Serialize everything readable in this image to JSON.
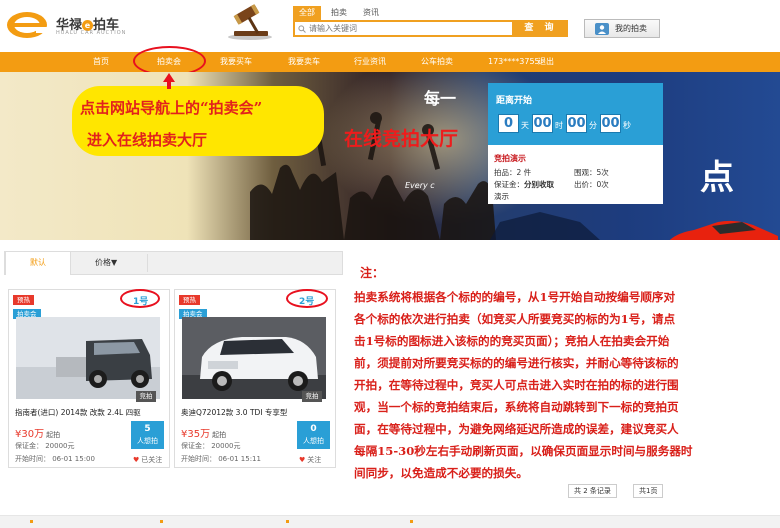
{
  "brand": {
    "name": "华禄",
    "badge": "e",
    "suffix": "拍车",
    "sub": "HUALU CAR AUCTION"
  },
  "search": {
    "tabs": [
      "全部",
      "拍卖",
      "资讯"
    ],
    "placeholder": "请输入关键词",
    "button": "查 询"
  },
  "my_auction": "我的拍卖",
  "nav": {
    "items": [
      "首页",
      "拍卖会",
      "我要买车",
      "我要卖车",
      "行业资讯",
      "公车拍卖"
    ],
    "user": "173****3755",
    "logout": "退出"
  },
  "banner": {
    "note_lines": [
      "点击网站导航上的“拍卖会”",
      "进入在线拍卖大厅"
    ],
    "title": "在线竞拍大厅",
    "every_text": "Every c",
    "dot_char": "点",
    "wave_text": "每一"
  },
  "countdown": {
    "label": "距离开始",
    "values": [
      "0",
      "00",
      "00",
      "00"
    ],
    "units": [
      "天",
      "时",
      "分",
      "秒"
    ],
    "title": "竞拍演示",
    "lots_label": "拍品：",
    "lots_value": "2 件",
    "views_label": "围观：",
    "views_value": "5次",
    "deposit_label": "保证金：",
    "deposit_value": "分别收取",
    "bids_label": "出价：",
    "bids_value": "0次",
    "demo": "演示"
  },
  "tabs": {
    "default": "默认",
    "price": "价格▼"
  },
  "cards": [
    {
      "badge_red": "预热",
      "badge_blue": "拍卖会",
      "number": "1号",
      "tag": "竞拍",
      "title": "指南者(进口) 2014款 改款 2.4L 四驱",
      "price": "¥30万",
      "price_suffix": "起拍",
      "deposit": "保证金：  20000元",
      "start": "开始时间：  06-01 15:00",
      "bidders_count": "5",
      "bidders_label": "人想拍",
      "follow": "已关注"
    },
    {
      "badge_red": "预热",
      "badge_blue": "拍卖会",
      "number": "2号",
      "tag": "竞拍",
      "title": "奥迪Q72012款 3.0 TDI 专享型",
      "price": "¥35万",
      "price_suffix": "起拍",
      "deposit": "保证金：  20000元",
      "start": "开始时间：  06-01 15:11",
      "bidders_count": "0",
      "bidders_label": "人想拍",
      "follow": "关注"
    }
  ],
  "note": {
    "head": "注：",
    "lines": [
      "拍卖系统将根据各个标的的编号，从1号开始自动按编号顺序对",
      "各个标的依次进行拍卖（如竞买人所要竞买的标的为1号，请点",
      "击1号标的图标进入该标的的竞买页面）；竞拍人在拍卖会开始",
      "前，须提前对所要竞买标的的编号进行核实，并耐心等待该标的",
      "开拍，在等待过程中，竞买人可点击进入实时在拍的标的进行围",
      "观，当一个标的竞拍结束后，系统将自动跳转到下一标的竞拍页",
      "面，在等待过程中，为避免网络延迟所造成的误差，建议竞买人",
      "每隔15-30秒左右手动刷新页面，以确保页面显示时间与服务器时",
      "间同步，以免造成不必要的损失。"
    ]
  },
  "pager": {
    "records": "共 2 条记录",
    "pages": "共1页"
  },
  "colors": {
    "accent": "#f39c12",
    "blue": "#2a9fd6",
    "red": "#d9201a",
    "yellow": "#ffe600"
  }
}
